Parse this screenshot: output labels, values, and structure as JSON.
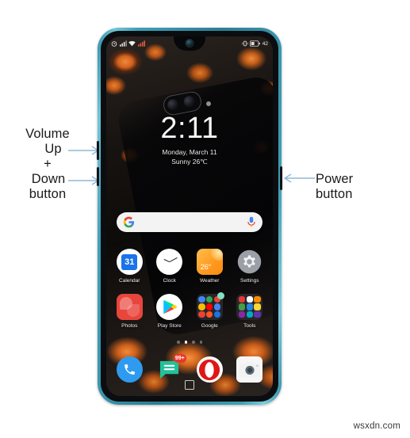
{
  "annotations": {
    "volume": {
      "lines": [
        "Volume",
        "Up",
        "+",
        "Down",
        "button"
      ],
      "arrow_color": "#8fb8d4"
    },
    "power": {
      "lines": [
        "Power",
        "button"
      ],
      "arrow_color": "#8fb8d4"
    }
  },
  "phone": {
    "frame_color": "#3f9fb4",
    "bezel_color": "#0b0d10",
    "hardware_buttons": [
      {
        "name": "volume-up-button"
      },
      {
        "name": "volume-down-button"
      },
      {
        "name": "power-button"
      }
    ],
    "statusbar": {
      "left_icons": [
        "alarm-icon",
        "signal-bars-icon",
        "wifi-icon",
        "sim-signal-icon"
      ],
      "right_icons": [
        "vibrate-icon",
        "battery-icon"
      ],
      "battery_text": "42"
    },
    "clock_widget": {
      "time": "2:11",
      "date": "Monday, March 11",
      "weather": "Sunny 26℃"
    },
    "search": {
      "logo": "google-g-icon",
      "placeholder": "",
      "value": "",
      "mic": "microphone-icon"
    },
    "apps_row_1": [
      {
        "label": "Calendar",
        "icon": "calendar-icon",
        "badge_text": "31"
      },
      {
        "label": "Clock",
        "icon": "clock-icon"
      },
      {
        "label": "Weather",
        "icon": "weather-icon",
        "temp": "26°"
      },
      {
        "label": "Settings",
        "icon": "gear-icon"
      }
    ],
    "apps_row_2": [
      {
        "label": "Photos",
        "icon": "photos-icon"
      },
      {
        "label": "Play Store",
        "icon": "play-store-icon"
      },
      {
        "label": "Google",
        "icon": "google-folder-icon"
      },
      {
        "label": "Tools",
        "icon": "tools-folder-icon"
      }
    ],
    "page_dots": {
      "count": 4,
      "active_index": 1
    },
    "dock": [
      {
        "label": "Phone",
        "icon": "phone-icon"
      },
      {
        "label": "Messages",
        "icon": "messages-icon",
        "badge": "99+"
      },
      {
        "label": "Opera",
        "icon": "opera-icon"
      },
      {
        "label": "Camera",
        "icon": "camera-icon"
      }
    ],
    "nav": {
      "recents": "recents-square-icon"
    }
  },
  "watermark": "wsxdn.com"
}
